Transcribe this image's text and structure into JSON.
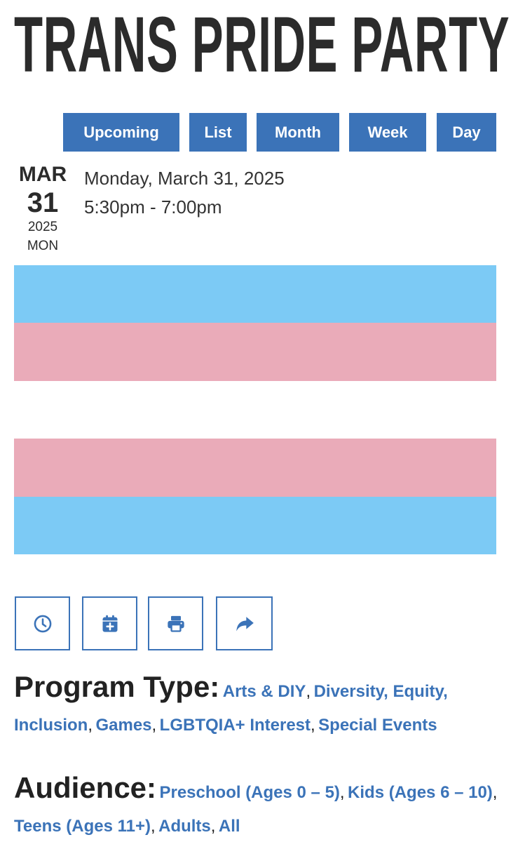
{
  "page": {
    "title": "TRANS PRIDE PARTY"
  },
  "view_nav": {
    "items": [
      {
        "label": "Upcoming"
      },
      {
        "label": "List"
      },
      {
        "label": "Month"
      },
      {
        "label": "Week"
      },
      {
        "label": "Day"
      }
    ]
  },
  "event": {
    "month": "MAR",
    "day": "31",
    "year": "2025",
    "weekday": "MON",
    "full_date": "Monday, March 31, 2025",
    "time_range": "5:30pm - 7:00pm"
  },
  "flag": {
    "stripes": [
      "#7ccaf5",
      "#eaabb9",
      "#ffffff",
      "#eaabb9",
      "#7ccaf5"
    ]
  },
  "tools": [
    {
      "icon": "clock-icon"
    },
    {
      "icon": "calendar-plus-icon"
    },
    {
      "icon": "print-icon"
    },
    {
      "icon": "share-icon"
    }
  ],
  "program_type": {
    "label": "Program Type:",
    "values": [
      "Arts & DIY",
      "Diversity, Equity, Inclusion",
      "Games",
      "LGBTQIA+ Interest",
      "Special Events"
    ]
  },
  "audience": {
    "label": "Audience:",
    "values": [
      "Preschool (Ages 0 – 5)",
      "Kids (Ages 6 – 10)",
      "Teens (Ages 11+)",
      "Adults",
      "All"
    ]
  },
  "colors": {
    "accent": "#3b73b8",
    "text": "#222222"
  },
  "separator": ","
}
